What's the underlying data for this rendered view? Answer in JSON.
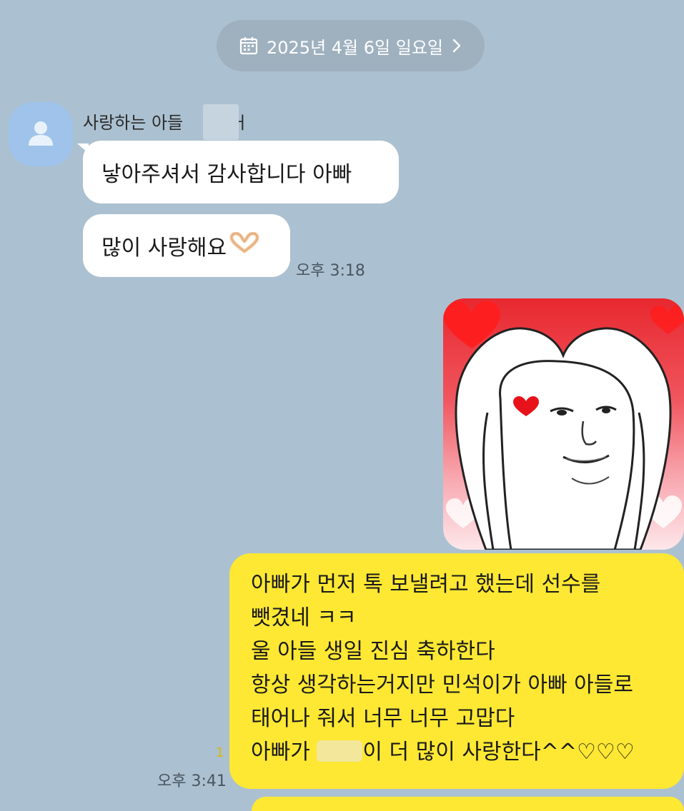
{
  "date_divider": {
    "label": "2025년 4월 6일 일요일",
    "icon": "calendar-icon",
    "chevron": "chevron-right-icon"
  },
  "received": {
    "sender_name": "사랑하는 아들",
    "sender_name_suffix": "ㅓ",
    "avatar_icon": "person-icon",
    "messages": [
      {
        "text": "낳아주셔서 감사합니다 아빠"
      },
      {
        "text": "많이 사랑해요",
        "emoji": "heart-hands-emoji"
      }
    ],
    "time": "오후 3:18"
  },
  "sent": {
    "sticker": "heart-arms-face-sticker",
    "lines": [
      "아빠가 먼저 톡 보낼려고 했는데 선수를",
      "뺏겼네 ㅋㅋ",
      "울 아들 생일 진심 축하한다",
      "항상 생각하는거지만 민석이가 아빠 아들로",
      "태어나 줘서 너무 너무 고맙다"
    ],
    "last_line_prefix": "아빠가",
    "last_line_suffix": "이 더 많이 사랑한다^^♡♡♡",
    "read_count": "1",
    "time": "오후 3:41"
  },
  "colors": {
    "background": "#abc1d1",
    "received_bubble": "#ffffff",
    "sent_bubble": "#fee833",
    "date_pill": "#9fb1bf",
    "unread_badge": "#e2b400"
  }
}
